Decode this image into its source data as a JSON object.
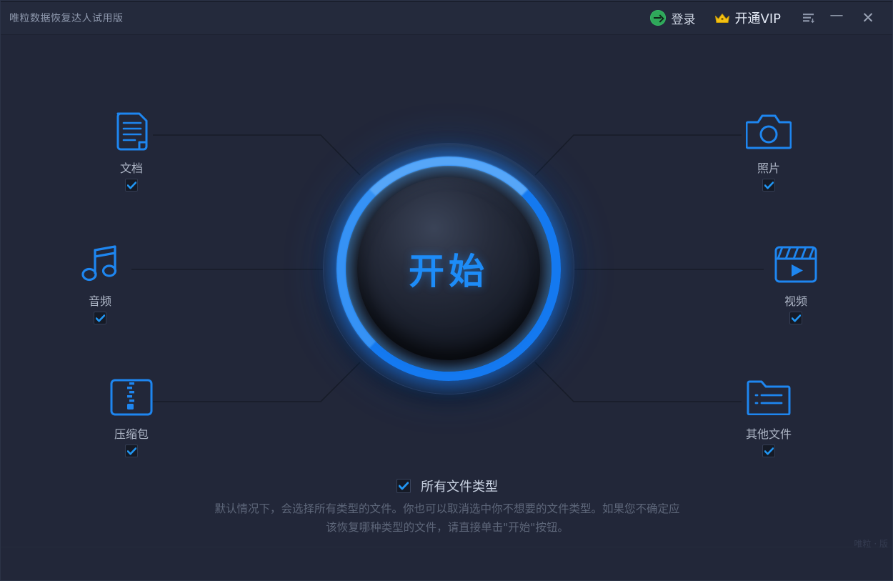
{
  "window": {
    "title": "唯粒数据恢复达人试用版",
    "minimize_label": "—",
    "close_label": "✕"
  },
  "titlebar": {
    "login_label": "登录",
    "vip_label": "开通VIP",
    "login_icon": "login-arrow-icon",
    "crown_icon": "crown-icon",
    "menu_icon": "menu-list-icon"
  },
  "start_button": {
    "label": "开始"
  },
  "file_types": [
    {
      "id": "document",
      "label": "文档",
      "icon": "document-icon",
      "checked": true
    },
    {
      "id": "photo",
      "label": "照片",
      "icon": "camera-icon",
      "checked": true
    },
    {
      "id": "audio",
      "label": "音频",
      "icon": "music-note-icon",
      "checked": true
    },
    {
      "id": "video",
      "label": "视频",
      "icon": "film-clapper-icon",
      "checked": true
    },
    {
      "id": "archive",
      "label": "压缩包",
      "icon": "zip-archive-icon",
      "checked": true
    },
    {
      "id": "other",
      "label": "其他文件",
      "icon": "folder-icon",
      "checked": true
    }
  ],
  "all_types": {
    "label": "所有文件类型",
    "checked": true
  },
  "hint": {
    "line1": "默认情况下，会选择所有类型的文件。你也可以取消选中你不想要的文件类型。如果您不确定应",
    "line2": "该恢复哪种类型的文件，请直接单击\"开始\"按钮。"
  },
  "footer": {
    "text": "唯粒 · 版"
  },
  "colors": {
    "background": "#222739",
    "titlebar": "#242a3c",
    "accent_blue": "#1d8cf8",
    "ring_blue": "#1479f0",
    "icon_blue": "#1e86f0",
    "label_gray": "#aeb6c6",
    "hint_gray": "#5d6679",
    "login_green": "#2fa85a",
    "crown_gold": "#f2c game"
  }
}
